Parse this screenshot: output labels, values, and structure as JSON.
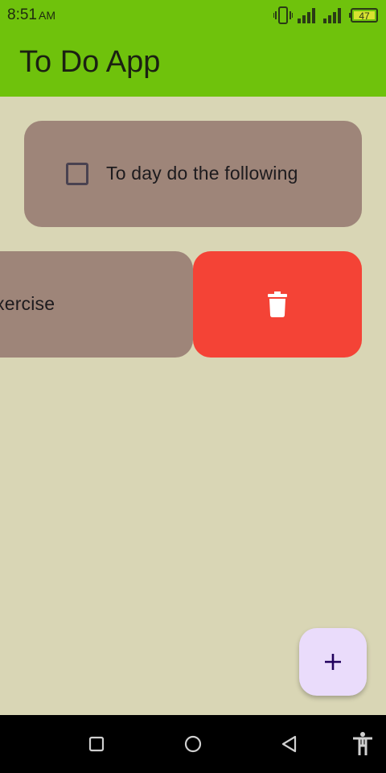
{
  "status_bar": {
    "time": "8:51",
    "ampm": "AM",
    "battery": "47",
    "icons": [
      "vibrate-icon",
      "signal-icon",
      "signal-icon",
      "battery-icon"
    ]
  },
  "app_bar": {
    "title": "To Do App",
    "color": "#6fc20c"
  },
  "tasks": [
    {
      "text": "To day do the following",
      "checked": false
    },
    {
      "text": "Exercise",
      "visible_text": "xercise",
      "checked": false,
      "swiped": true
    }
  ],
  "delete_action": {
    "icon": "trash-icon",
    "color": "#f44336"
  },
  "fab": {
    "icon": "plus-icon",
    "color": "#eadcfb"
  },
  "nav_bar": {
    "buttons": [
      "recents-icon",
      "home-icon",
      "back-icon",
      "accessibility-icon"
    ]
  },
  "colors": {
    "background": "#d9d6b5",
    "card": "#9e8579"
  }
}
